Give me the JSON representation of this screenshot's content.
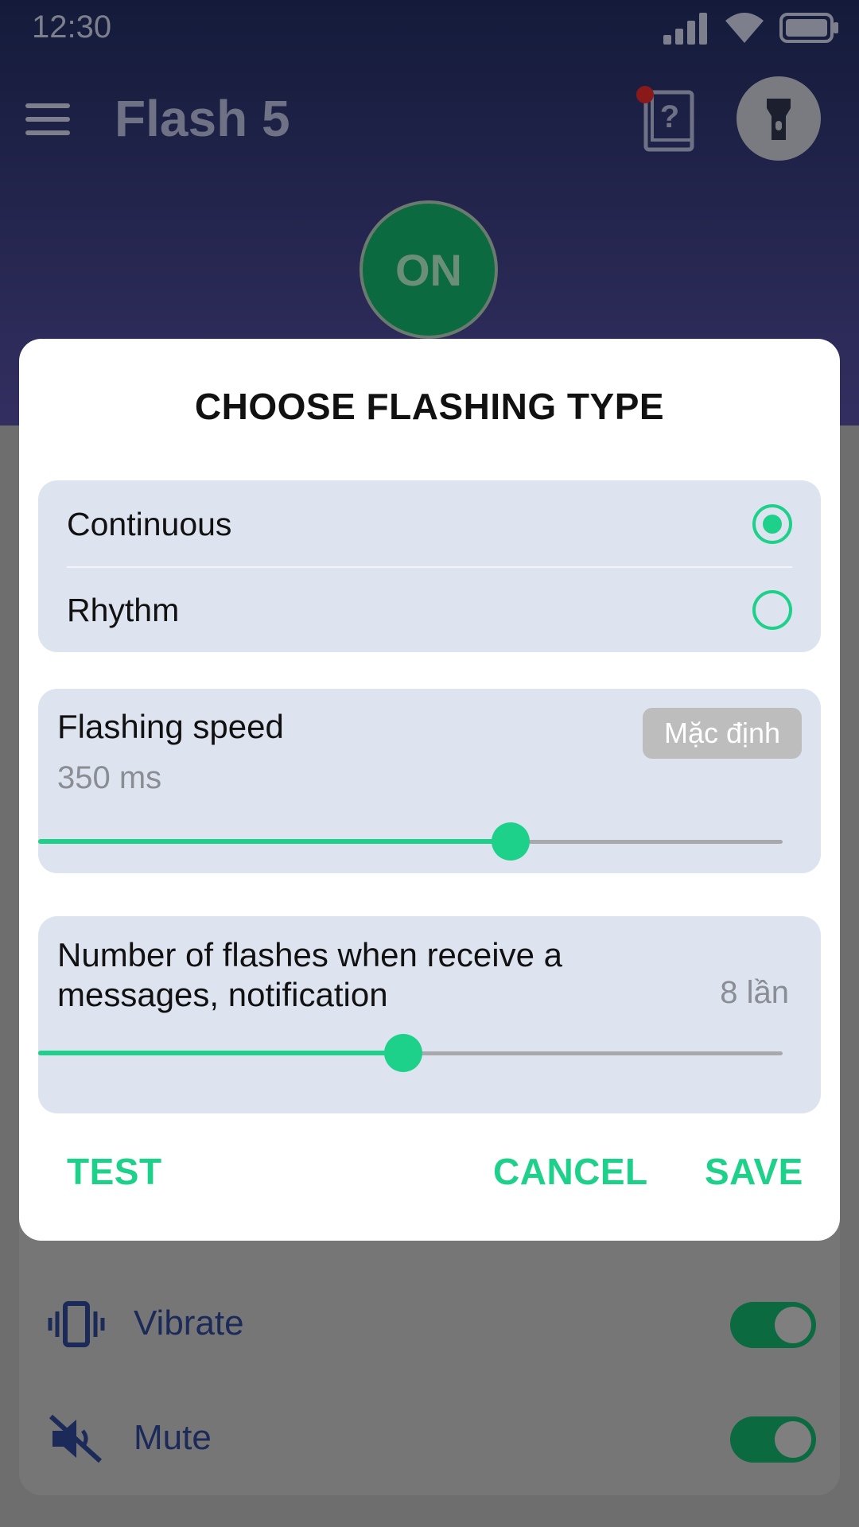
{
  "status_bar": {
    "time": "12:30"
  },
  "app": {
    "title": "Flash 5",
    "on_label": "ON"
  },
  "settings": [
    {
      "label": "Vibrate",
      "icon": "vibrate-icon",
      "enabled": true
    },
    {
      "label": "Mute",
      "icon": "mute-icon",
      "enabled": true
    }
  ],
  "dialog": {
    "title": "CHOOSE FLASHING TYPE",
    "types": [
      {
        "label": "Continuous",
        "selected": true
      },
      {
        "label": "Rhythm",
        "selected": false
      }
    ],
    "speed": {
      "label": "Flashing speed",
      "value_text": "350 ms",
      "default_label": "Mặc định",
      "slider_fraction": 0.635
    },
    "count": {
      "label": "Number of flashes when receive a messages, notification",
      "value_text": "8 lần",
      "slider_fraction": 0.49
    },
    "actions": {
      "test": "TEST",
      "cancel": "CANCEL",
      "save": "SAVE"
    }
  },
  "colors": {
    "accent": "#1ed18a",
    "header_top": "#141b3a",
    "header_bottom": "#332f61",
    "on_button": "#0b6a3f",
    "panel": "#dde3ef"
  }
}
